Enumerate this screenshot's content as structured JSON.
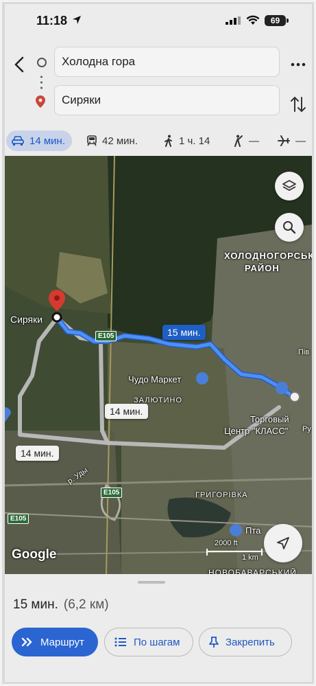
{
  "status_bar": {
    "time": "11:18",
    "battery": "69"
  },
  "search": {
    "origin": "Холодна гора",
    "destination": "Сиряки"
  },
  "modes": [
    {
      "icon": "car-icon",
      "label": "14 мин.",
      "active": true
    },
    {
      "icon": "train-icon",
      "label": "42 мин."
    },
    {
      "icon": "walk-icon",
      "label": "1 ч. 14"
    },
    {
      "icon": "rideshare-icon",
      "label": "—"
    },
    {
      "icon": "plane-icon",
      "label": "—"
    }
  ],
  "map": {
    "places": {
      "siryaky": "Сиряки",
      "district_line1": "ХОЛОДНОГОРСЬКИЙ",
      "district_line2": "РАЙОН",
      "chudo": "Чудо Маркет",
      "zalyutyno": "ЗАЛЮТИНО",
      "mall_line1": "Торговый",
      "mall_line2": "Центр \"КЛАСС\"",
      "hryhorivka": "ГРИГОРІВКА",
      "novobavarsky": "НОВОБАВАРСЬКИЙ",
      "ptah": "Пта",
      "udy": "р. Уды",
      "piv": "Пів",
      "ru": "Ру"
    },
    "roads": [
      "E105",
      "E105",
      "E105"
    ],
    "route_times": {
      "primary": "15 мин.",
      "alt1": "14 мин.",
      "alt2": "14 мин."
    },
    "scale": "2000 ft",
    "scale_metric": "1 km",
    "logo": "Google"
  },
  "sheet": {
    "duration": "15 мин.",
    "distance": "(6,2 км)"
  },
  "actions": {
    "route": "Маршрут",
    "steps": "По шагам",
    "pin": "Закрепить"
  },
  "colors": {
    "route_primary": "#3d7cf0",
    "route_alt": "#b9b9b9",
    "accent": "#2a65d1"
  }
}
